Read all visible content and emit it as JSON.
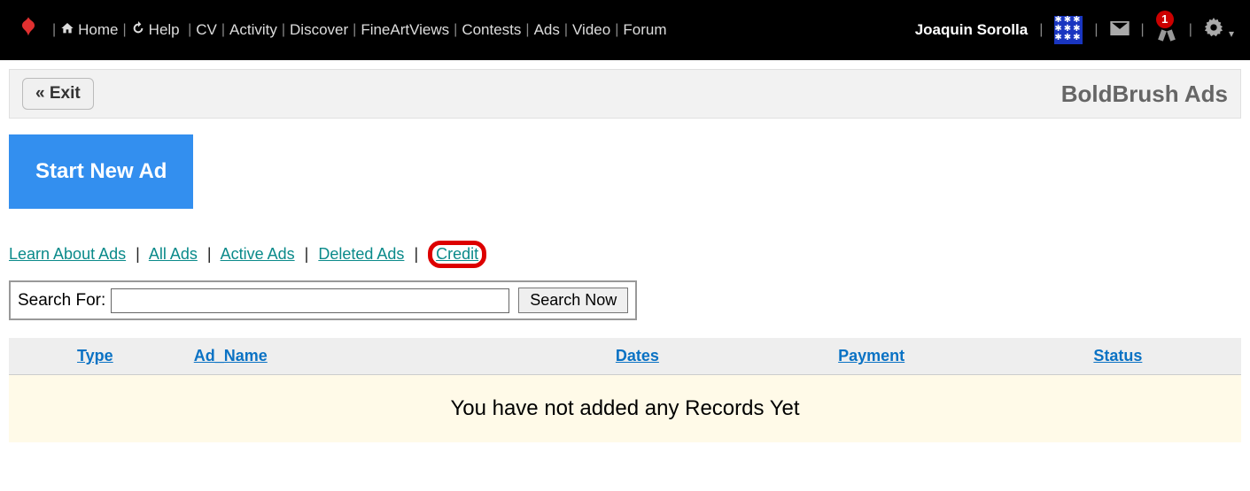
{
  "topbar": {
    "nav": {
      "home": "Home",
      "help": "Help",
      "cv": "CV",
      "activity": "Activity",
      "discover": "Discover",
      "fineartviews": "FineArtViews",
      "contests": "Contests",
      "ads": "Ads",
      "video": "Video",
      "forum": "Forum"
    },
    "username": "Joaquin Sorolla",
    "badge_count": "1"
  },
  "pagebar": {
    "exit_label": "« Exit",
    "title": "BoldBrush Ads"
  },
  "main": {
    "start_button": "Start New Ad",
    "links": {
      "learn": "Learn About Ads",
      "all": "All Ads",
      "active": "Active Ads",
      "deleted": "Deleted Ads",
      "credit": "Credit"
    },
    "search": {
      "label": "Search For:",
      "button": "Search Now",
      "value": ""
    },
    "table": {
      "headers": {
        "type": "Type",
        "ad_name": "Ad_Name",
        "dates": "Dates",
        "payment": "Payment",
        "status": "Status"
      },
      "empty_message": "You have not added any Records Yet"
    }
  }
}
